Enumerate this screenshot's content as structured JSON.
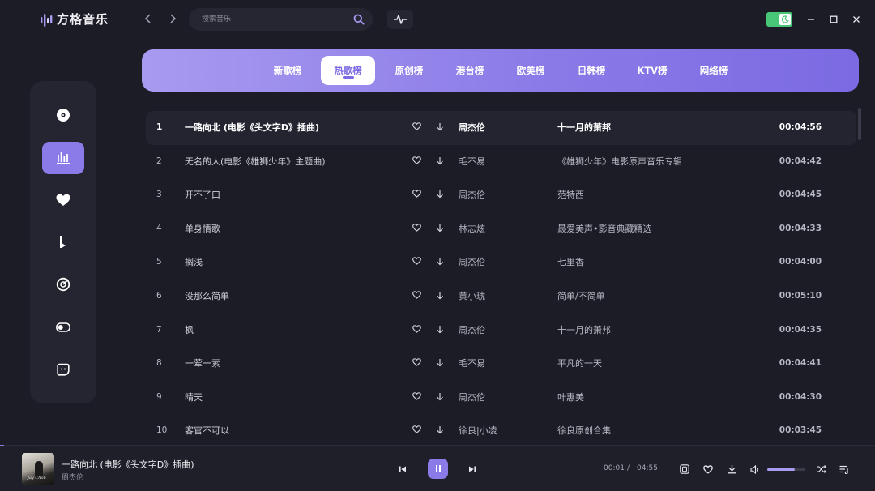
{
  "app": {
    "name": "方格音乐"
  },
  "search": {
    "placeholder": "搜索音乐"
  },
  "tabs": [
    {
      "label": "新歌榜",
      "active": false
    },
    {
      "label": "热歌榜",
      "active": true
    },
    {
      "label": "原创榜",
      "active": false
    },
    {
      "label": "港台榜",
      "active": false
    },
    {
      "label": "欧美榜",
      "active": false
    },
    {
      "label": "日韩榜",
      "active": false
    },
    {
      "label": "KTV榜",
      "active": false
    },
    {
      "label": "网络榜",
      "active": false
    }
  ],
  "sidebar": {
    "items": [
      {
        "icon": "disc-icon",
        "active": false
      },
      {
        "icon": "chart-bars-icon",
        "active": true
      },
      {
        "icon": "heart-icon",
        "active": false
      },
      {
        "icon": "music-note-icon",
        "active": false
      },
      {
        "icon": "target-icon",
        "active": false
      },
      {
        "icon": "toggle-icon",
        "active": false
      },
      {
        "icon": "face-icon",
        "active": false
      }
    ]
  },
  "songs": [
    {
      "index": "1",
      "title": "一路向北 (电影《头文字D》插曲)",
      "artist": "周杰伦",
      "album": "十一月的萧邦",
      "duration": "00:04:56"
    },
    {
      "index": "2",
      "title": "无名的人(电影《雄狮少年》主题曲)",
      "artist": "毛不易",
      "album": "《雄狮少年》电影原声音乐专辑",
      "duration": "00:04:42"
    },
    {
      "index": "3",
      "title": "开不了口",
      "artist": "周杰伦",
      "album": "范特西",
      "duration": "00:04:45"
    },
    {
      "index": "4",
      "title": "单身情歌",
      "artist": "林志炫",
      "album": "最爱美声•影音典藏精选",
      "duration": "00:04:33"
    },
    {
      "index": "5",
      "title": "搁浅",
      "artist": "周杰伦",
      "album": "七里香",
      "duration": "00:04:00"
    },
    {
      "index": "6",
      "title": "没那么简单",
      "artist": "黄小琥",
      "album": "简单/不简单",
      "duration": "00:05:10"
    },
    {
      "index": "7",
      "title": "枫",
      "artist": "周杰伦",
      "album": "十一月的萧邦",
      "duration": "00:04:35"
    },
    {
      "index": "8",
      "title": "一荤一素",
      "artist": "毛不易",
      "album": "平凡的一天",
      "duration": "00:04:41"
    },
    {
      "index": "9",
      "title": "晴天",
      "artist": "周杰伦",
      "album": "叶惠美",
      "duration": "00:04:30"
    },
    {
      "index": "10",
      "title": "客官不可以",
      "artist": "徐良|小凌",
      "album": "徐良原创合集",
      "duration": "00:03:45"
    }
  ],
  "player": {
    "title": "一路向北 (电影《头文字D》插曲)",
    "artist": "周杰伦",
    "current_time": "00:01",
    "separator": "/",
    "total_time": "04:55",
    "progress": 0.005,
    "volume": 0.72,
    "cover_text": "Jay Chou"
  },
  "colors": {
    "accent": "#8b7be8",
    "toggle_on": "#49c779",
    "background": "#1c1c26"
  }
}
